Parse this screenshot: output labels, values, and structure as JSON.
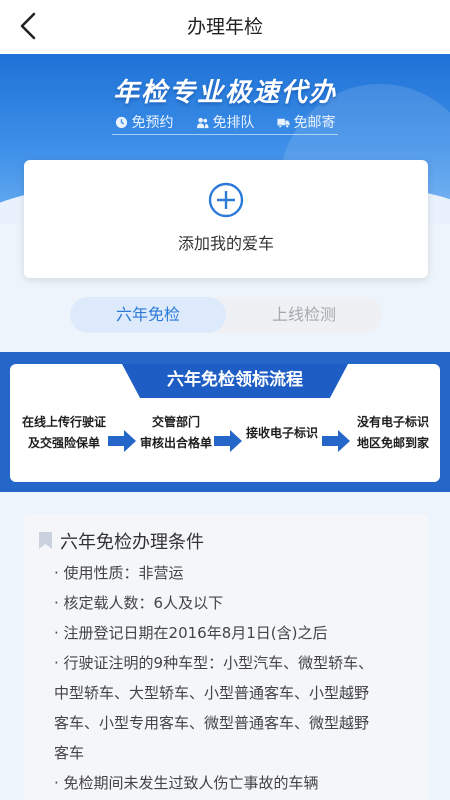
{
  "header": {
    "title": "办理年检",
    "back_icon": "chevron-left-icon"
  },
  "hero": {
    "slogan": "年检专业极速代办",
    "features": [
      {
        "icon": "clock-icon",
        "label": "免预约"
      },
      {
        "icon": "people-icon",
        "label": "免排队"
      },
      {
        "icon": "truck-icon",
        "label": "免邮寄"
      }
    ]
  },
  "add_car": {
    "icon": "plus-circle-icon",
    "label": "添加我的爱车"
  },
  "tabs": [
    {
      "label": "六年免检",
      "active": true
    },
    {
      "label": "上线检测",
      "active": false
    }
  ],
  "flow": {
    "title": "六年免检领标流程",
    "steps": [
      {
        "line1": "在线上传行驶证",
        "line2": "及交强险保单"
      },
      {
        "line1": "交管部门",
        "line2": "审核出合格单"
      },
      {
        "line1": "接收电子标识",
        "line2": ""
      },
      {
        "line1": "没有电子标识",
        "line2": "地区免邮到家"
      }
    ]
  },
  "conditions": {
    "title": "六年免检办理条件",
    "items": [
      "· 使用性质：非营运",
      "· 核定载人数：6人及以下",
      "· 注册登记日期在2016年8月1日(含)之后",
      "· 行驶证注明的9种车型：小型汽车、微型轿车、",
      "中型轿车、大型轿车、小型普通客车、小型越野",
      "客车、小型专用客车、微型普通客车、微型越野",
      "客车",
      "· 免检期间未发生过致人伤亡事故的车辆"
    ]
  },
  "colors": {
    "accent": "#2c7ad8",
    "hero_blue": "#1f72d6",
    "flow_blue": "#2467c8",
    "tab_active_bg": "#dceafb"
  }
}
